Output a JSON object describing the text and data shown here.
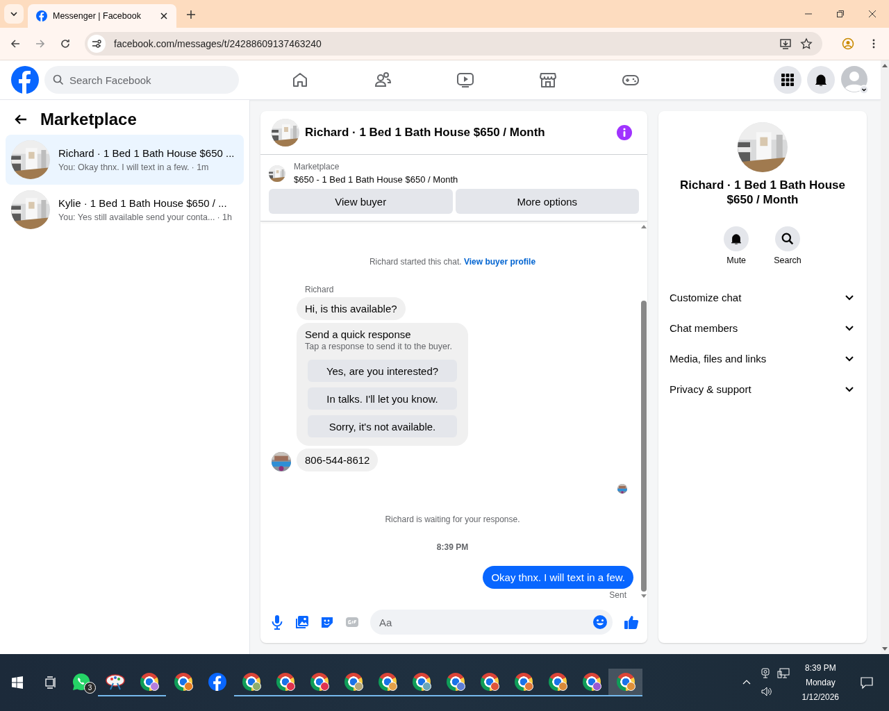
{
  "browser": {
    "tab_title": "Messenger | Facebook",
    "url": "facebook.com/messages/t/24288609137463240"
  },
  "navbar": {
    "search_placeholder": "Search Facebook",
    "nav_icons": [
      {
        "kind": "home"
      },
      {
        "kind": "friends"
      },
      {
        "kind": "video"
      },
      {
        "kind": "marketplace"
      },
      {
        "kind": "gaming"
      }
    ]
  },
  "sidebar": {
    "title": "Marketplace",
    "threads": [
      {
        "title": "Richard · 1 Bed 1 Bath House $650 ...",
        "preview": "You: Okay thnx. I will text in a few.",
        "time": "· 1m",
        "selected": true
      },
      {
        "title": "Kylie · 1 Bed 1 Bath House $650 / ...",
        "preview": "You: Yes still available send your conta...",
        "time": "· 1h",
        "selected": false
      }
    ]
  },
  "chat": {
    "title": "Richard · 1 Bed 1 Bath House $650 / Month",
    "listing": {
      "label": "Marketplace",
      "text": "$650 - 1 Bed 1 Bath House $650 / Month"
    },
    "actions": [
      "View buyer",
      "More options"
    ],
    "messages": [
      {
        "kind": "system",
        "text": "Richard started this chat.",
        "link": "View buyer profile"
      },
      {
        "kind": "sender",
        "text": "Richard"
      },
      {
        "kind": "incoming",
        "text": "Hi, is this available?",
        "avatar": false
      },
      {
        "kind": "quick_response",
        "title": "Send a quick response",
        "subtitle": "Tap a response to send it to the buyer.",
        "options": [
          "Yes, are you interested?",
          "In talks. I'll let you know.",
          "Sorry, it's not available."
        ]
      },
      {
        "kind": "incoming",
        "text": "806-544-8612",
        "avatar": true
      },
      {
        "kind": "seen"
      },
      {
        "kind": "system",
        "text": "Richard is waiting for your response."
      },
      {
        "kind": "timestamp",
        "text": "8:39 PM"
      },
      {
        "kind": "outgoing",
        "text": "Okay thnx. I will text in a few.",
        "status": "Sent"
      }
    ],
    "composer": {
      "placeholder": "Aa"
    }
  },
  "details": {
    "name": "Richard · 1 Bed 1 Bath House $650 / Month",
    "actions": [
      {
        "kind": "mute",
        "label": "Mute"
      },
      {
        "kind": "search",
        "label": "Search"
      }
    ],
    "sections": [
      {
        "label": "Customize chat",
        "expanded": false
      },
      {
        "label": "Chat members",
        "expanded": false
      },
      {
        "label": "Media, files and links",
        "expanded": false
      },
      {
        "label": "Privacy & support",
        "expanded": false
      }
    ]
  },
  "taskbar": {
    "apps": [
      {
        "kind": "whatsapp",
        "badge": "3",
        "running": false,
        "selected": false
      },
      {
        "kind": "paint",
        "running": true,
        "selected": false
      },
      {
        "kind": "chrome",
        "color": "#b57edc",
        "running": true,
        "selected": false
      },
      {
        "kind": "chrome",
        "color": "#e67e22",
        "running": false,
        "selected": false
      },
      {
        "kind": "facebook",
        "running": false,
        "selected": false
      },
      {
        "kind": "chrome",
        "color": "#8fae6b",
        "running": true,
        "selected": false
      },
      {
        "kind": "chrome",
        "color": "#e0334f",
        "running": true,
        "selected": false
      },
      {
        "kind": "chrome",
        "color": "#e0334f",
        "running": true,
        "selected": false
      },
      {
        "kind": "chrome",
        "color": "#b5a878",
        "running": true,
        "selected": false
      },
      {
        "kind": "chrome",
        "color": "#e5a14a",
        "running": true,
        "selected": false
      },
      {
        "kind": "chrome",
        "color": "#6aa7b8",
        "running": true,
        "selected": false
      },
      {
        "kind": "chrome",
        "color": "#5f7fd6",
        "running": true,
        "selected": false
      },
      {
        "kind": "chrome",
        "color": "#e0553a",
        "running": true,
        "selected": false
      },
      {
        "kind": "chrome",
        "color": "#e07a3a",
        "running": true,
        "selected": false
      },
      {
        "kind": "chrome",
        "color": "#d98a3a",
        "running": true,
        "selected": false
      },
      {
        "kind": "chrome",
        "color": "#9b59d0",
        "running": true,
        "selected": false
      },
      {
        "kind": "chrome",
        "color": "#e0913a",
        "running": true,
        "selected": true
      }
    ],
    "clock": {
      "time": "8:39 PM",
      "day": "Monday",
      "date": "1/12/2026"
    }
  }
}
